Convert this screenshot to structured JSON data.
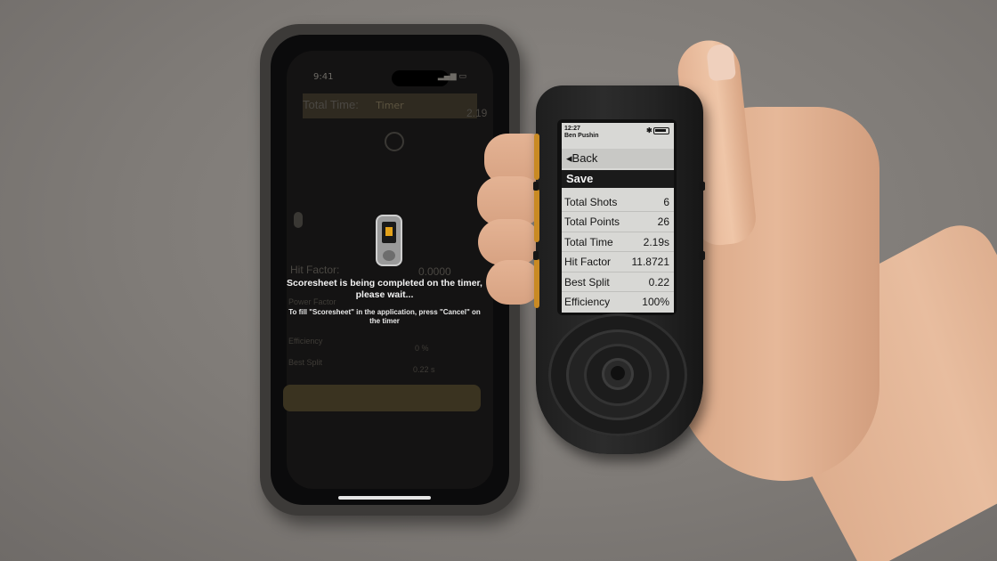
{
  "phone": {
    "status_time": "9:41",
    "header_title": "Timer",
    "total_time_label": "Total Time:",
    "total_time_value": "2.19",
    "hit_factor_label": "Hit Factor:",
    "hit_factor_value": "0.0000",
    "overlay_message": "Scoresheet is being completed on the timer, please wait...",
    "overlay_hint": "To fill \"Scoresheet\" in the application, press \"Cancel\" on the timer",
    "faded_rows": [
      "Power Factor",
      "Efficiency",
      "Best Split"
    ],
    "faded_values": [
      "0 %",
      "0.22 s"
    ]
  },
  "timer": {
    "time": "12:27",
    "user": "Ben Pushin",
    "back_label": "◂Back",
    "save_label": "Save",
    "stats": [
      {
        "label": "Total Shots",
        "value": "6"
      },
      {
        "label": "Total Points",
        "value": "26"
      },
      {
        "label": "Total Time",
        "value": "2.19s"
      },
      {
        "label": "Hit Factor",
        "value": "11.8721"
      },
      {
        "label": "Best Split",
        "value": "0.22"
      },
      {
        "label": "Efficiency",
        "value": "100%"
      }
    ],
    "accent_color": "#c98a23"
  }
}
